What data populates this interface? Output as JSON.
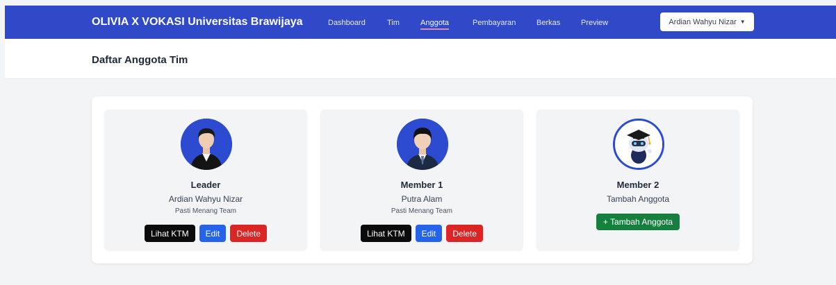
{
  "navbar": {
    "brand": "OLIVIA X VOKASI Universitas Brawijaya",
    "links": [
      {
        "label": "Dashboard"
      },
      {
        "label": "Tim"
      },
      {
        "label": "Anggota"
      },
      {
        "label": "Pembayaran"
      },
      {
        "label": "Berkas"
      },
      {
        "label": "Preview"
      }
    ],
    "active_link": "Anggota",
    "user_name": "Ardian Wahyu Nizar",
    "user_menu_icon": "chevron-down-icon"
  },
  "page": {
    "title": "Daftar Anggota Tim"
  },
  "members": [
    {
      "role": "Leader",
      "name": "Ardian Wahyu Nizar",
      "team": "Pasti Menang Team",
      "buttons": {
        "ktm": "Lihat KTM",
        "edit": "Edit",
        "delete": "Delete"
      }
    },
    {
      "role": "Member 1",
      "name": "Putra Alam",
      "team": "Pasti Menang Team",
      "buttons": {
        "ktm": "Lihat KTM",
        "edit": "Edit",
        "delete": "Delete"
      }
    },
    {
      "role": "Member 2",
      "name": "Tambah Anggota",
      "add_button": "+ Tambah Anggota"
    }
  ],
  "colors": {
    "navbar": "#2f49c8",
    "avatar_ring": "#2c4bd0",
    "btn_ktm": "#0b0b0b",
    "btn_edit": "#2563eb",
    "btn_delete": "#dc2626",
    "btn_add": "#15803d"
  }
}
